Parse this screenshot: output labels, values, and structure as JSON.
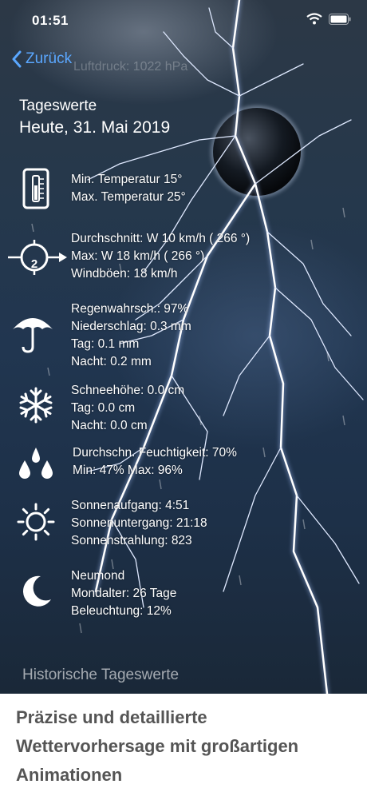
{
  "status_bar": {
    "time": "01:51"
  },
  "nav": {
    "back_label": "Zurück",
    "overlay_text": "Luftdruck: 1022 hPa"
  },
  "header": {
    "section_title": "Tageswerte",
    "date": "Heute, 31. Mai 2019"
  },
  "temperature": {
    "icon": "thermometer-icon",
    "lines": [
      "Min. Temperatur 15°",
      "Max. Temperatur 25°"
    ]
  },
  "wind": {
    "icon": "compass-icon",
    "compass_value": "2",
    "lines": [
      "Durchschnitt: W 10 km/h ( 266 °)",
      "Max: W 18 km/h ( 266 °)",
      "Windböen: 18 km/h"
    ]
  },
  "rain": {
    "icon": "umbrella-icon",
    "lines": [
      "Regenwahrsch.: 97%",
      "Niederschlag: 0.3 mm",
      "Tag: 0.1 mm",
      "Nacht: 0.2 mm"
    ]
  },
  "snow": {
    "icon": "snowflake-icon",
    "lines": [
      "Schneehöhe: 0.0 cm",
      "Tag: 0.0 cm",
      "Nacht: 0.0 cm"
    ]
  },
  "humidity": {
    "icon": "water-drops-icon",
    "lines": [
      "Durchschn. Feuchtigkeit: 70%",
      "Min: 47%  Max: 96%"
    ]
  },
  "sun": {
    "icon": "sun-icon",
    "lines": [
      "Sonnenaufgang: 4:51",
      "Sonnenuntergang: 21:18",
      "Sonnenstrahlung: 823"
    ]
  },
  "moon": {
    "icon": "moon-icon",
    "lines": [
      "Neumond",
      "Mondalter: 26 Tage",
      "Beleuchtung: 12%"
    ]
  },
  "footer": {
    "history_label": "Historische Tageswerte"
  },
  "caption": {
    "text": "Präzise und detaillierte Wettervorhersage mit großartigen Animationen"
  },
  "colors": {
    "link": "#5aa7ff",
    "caption_text": "#555555",
    "background_dark": "#213650"
  }
}
